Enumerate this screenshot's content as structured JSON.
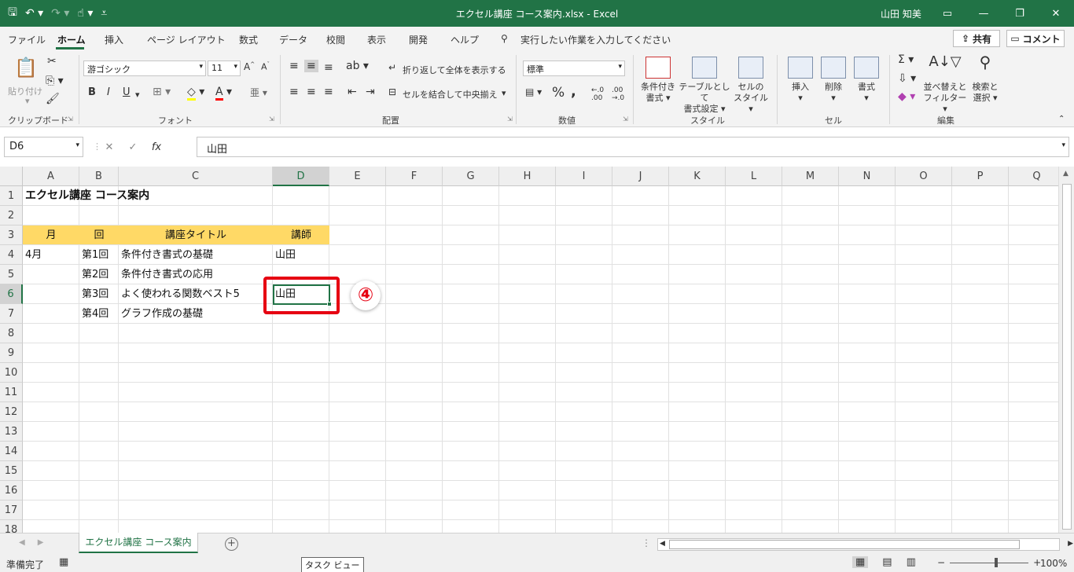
{
  "window": {
    "title": "エクセル講座 コース案内.xlsx  -  Excel",
    "user": "山田 知美",
    "qat": [
      "save-icon",
      "undo-icon",
      "redo-icon",
      "touch-mode-icon",
      "customize-icon"
    ],
    "buttons": [
      "ribbon-display-icon",
      "minimize-icon",
      "restore-icon",
      "close-icon"
    ]
  },
  "ribbon_tabs": [
    "ファイル",
    "ホーム",
    "挿入",
    "ページ レイアウト",
    "数式",
    "データ",
    "校閲",
    "表示",
    "開発",
    "ヘルプ"
  ],
  "active_tab": "ホーム",
  "tell_me": "実行したい作業を入力してください",
  "share": "共有",
  "comment": "コメント",
  "ribbon": {
    "clipboard": {
      "label": "クリップボード",
      "paste": "貼り付け"
    },
    "font": {
      "label": "フォント",
      "name": "游ゴシック",
      "size": "11",
      "bold": "B",
      "italic": "I",
      "underline": "U",
      "grow": "A",
      "shrink": "A"
    },
    "alignment": {
      "label": "配置",
      "wrap": "折り返して全体を表示する",
      "merge": "セルを結合して中央揃え"
    },
    "number": {
      "label": "数値",
      "format": "標準",
      "percent": "%",
      "comma": ","
    },
    "styles": {
      "label": "スタイル",
      "cond": [
        "条件付き",
        "書式"
      ],
      "table": [
        "テーブルとして",
        "書式設定"
      ],
      "cell": [
        "セルの",
        "スタイル"
      ]
    },
    "cells": {
      "label": "セル",
      "insert": "挿入",
      "delete": "削除",
      "format": "書式"
    },
    "editing": {
      "label": "編集",
      "sort": [
        "並べ替えと",
        "フィルター"
      ],
      "find": [
        "検索と",
        "選択"
      ]
    }
  },
  "formula_bar": {
    "name_box": "D6",
    "cancel": "✕",
    "enter": "✓",
    "fx": "fx",
    "content": "山田"
  },
  "columns": [
    "A",
    "B",
    "C",
    "D",
    "E",
    "F",
    "G",
    "H",
    "I",
    "J",
    "K",
    "L",
    "M",
    "N",
    "O",
    "P",
    "Q"
  ],
  "selected_column": "D",
  "rows": [
    "1",
    "2",
    "3",
    "4",
    "5",
    "6",
    "7",
    "8",
    "9",
    "10",
    "11",
    "12",
    "13",
    "14",
    "15",
    "16",
    "17",
    "18"
  ],
  "selected_row": "6",
  "cells": {
    "A1": "エクセル講座 コース案内",
    "A3": "月",
    "B3": "回",
    "C3": "講座タイトル",
    "D3": "講師",
    "A4": "4月",
    "B4": "第1回",
    "C4": "条件付き書式の基礎",
    "D4": "山田",
    "B5": "第2回",
    "C5": "条件付き書式の応用",
    "B6": "第3回",
    "C6": "よく使われる関数ベスト5",
    "D6": "山田",
    "B7": "第4回",
    "C7": "グラフ作成の基礎"
  },
  "header_fill": "#ffd966",
  "callout_color": "#e60012",
  "step_badge": "④",
  "sheet_tab": "エクセル講座 コース案内",
  "status": {
    "ready": "準備完了",
    "tooltip": "タスク ビュー",
    "zoom": "100%"
  },
  "colors": {
    "accent": "#217346"
  }
}
